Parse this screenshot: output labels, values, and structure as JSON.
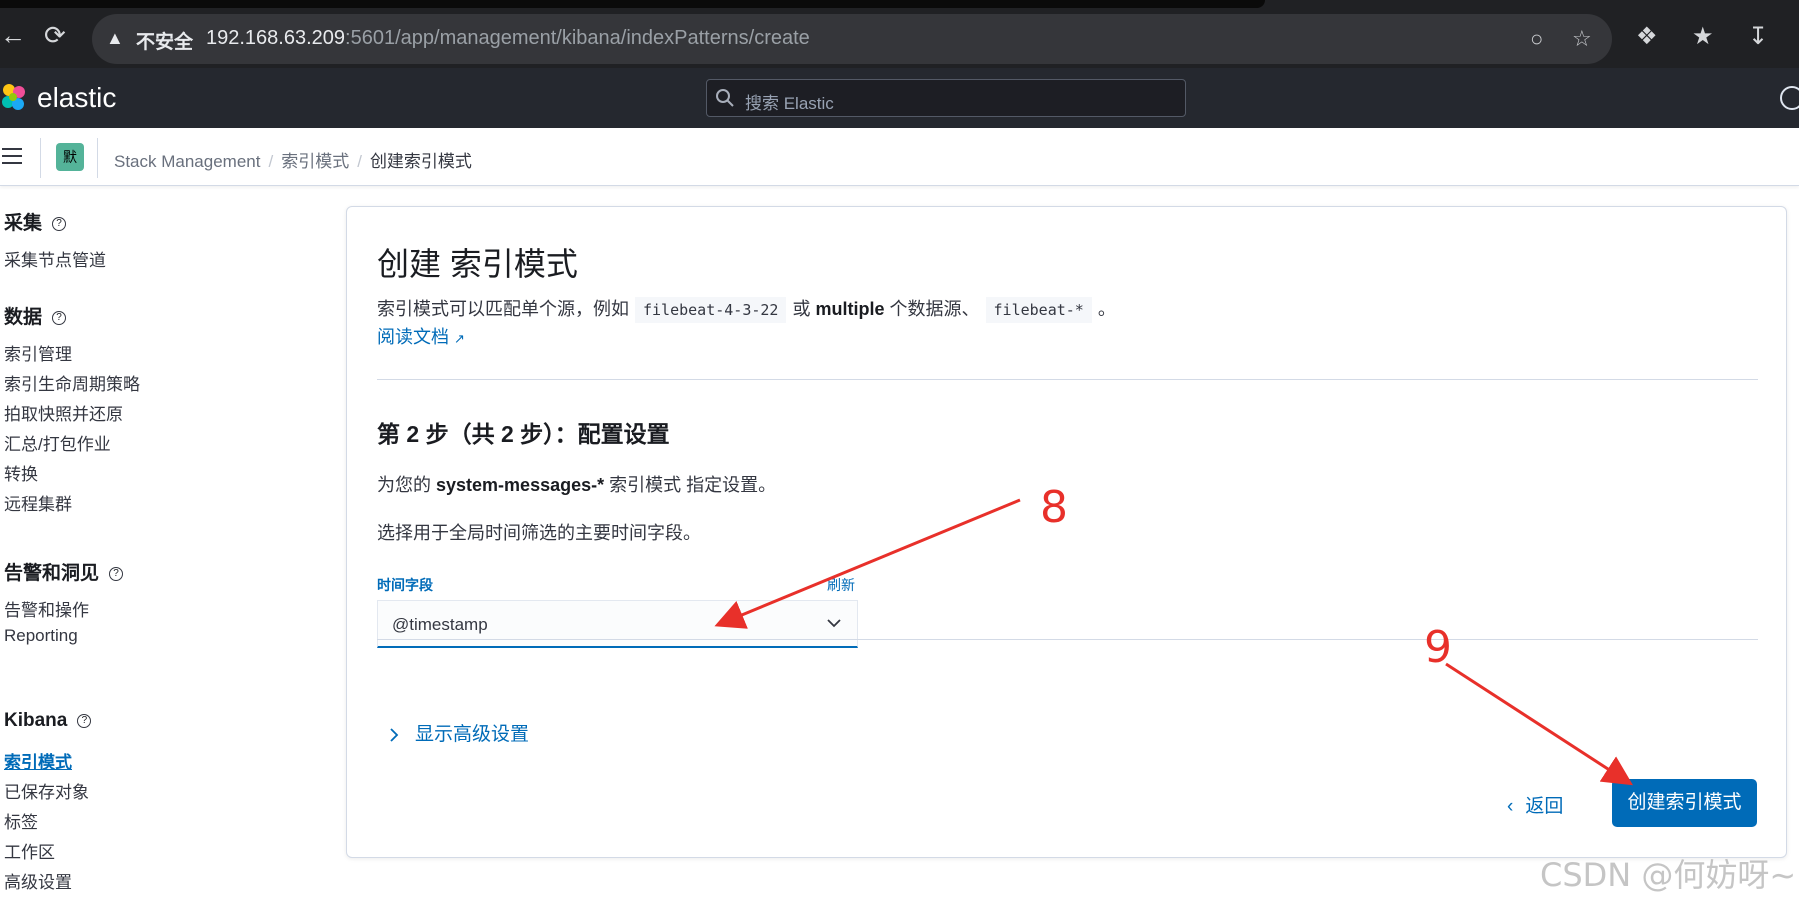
{
  "browser": {
    "security_label": "不安全",
    "url_host": "192.168.63.209",
    "url_rest": ":5601/app/management/kibana/indexPatterns/create"
  },
  "header": {
    "logo_text": "elastic",
    "search_placeholder": "搜索 Elastic"
  },
  "subheader": {
    "space_avatar": "默",
    "breadcrumbs": [
      "Stack Management",
      "索引模式",
      "创建索引模式"
    ]
  },
  "sidebar": {
    "sections": [
      {
        "title": "采集",
        "items": [
          "采集节点管道"
        ]
      },
      {
        "title": "数据",
        "items": [
          "索引管理",
          "索引生命周期策略",
          "拍取快照并还原",
          "汇总/打包作业",
          "转换",
          "远程集群"
        ]
      },
      {
        "title": "告警和洞见",
        "items": [
          "告警和操作",
          "Reporting"
        ]
      },
      {
        "title": "Kibana",
        "items": [
          "索引模式",
          "已保存对象",
          "标签",
          "工作区",
          "高级设置"
        ]
      }
    ],
    "active_item": "索引模式"
  },
  "main": {
    "title": "创建 索引模式",
    "desc_part1": "索引模式可以匹配单个源，例如",
    "desc_code1": "filebeat-4-3-22",
    "desc_or": "或",
    "desc_multiple": "multiple",
    "desc_part2": "个数据源、",
    "desc_code2": "filebeat-*",
    "desc_end": "。",
    "doc_link": "阅读文档",
    "step_title": "第 2 步（共 2 步）：配置设置",
    "step_desc_prefix": "为您的",
    "step_desc_pattern": "system-messages-*",
    "step_desc_suffix": "索引模式 指定设置。",
    "step_desc2": "选择用于全局时间筛选的主要时间字段。",
    "time_field_label": "时间字段",
    "refresh_label": "刷新",
    "time_field_value": "@timestamp",
    "advanced_label": "显示高级设置",
    "back_label": "返回",
    "create_label": "创建索引模式"
  },
  "annotations": {
    "label_8": "8",
    "label_9": "9",
    "color": "#e8302a"
  },
  "watermark": "CSDN @何妨呀~"
}
